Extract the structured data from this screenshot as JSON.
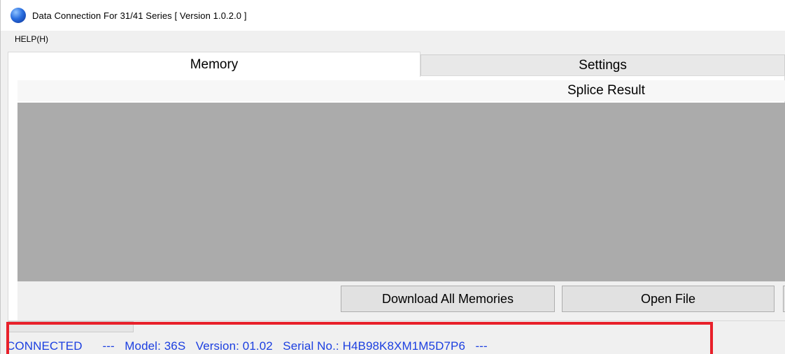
{
  "window": {
    "title": "Data Connection For 31/41 Series   [ Version 1.0.2.0 ]",
    "icon": "app-globe-icon"
  },
  "menu": {
    "items": [
      {
        "label": "HELP(H)"
      }
    ]
  },
  "tabs": [
    {
      "label": "Memory",
      "active": true
    },
    {
      "label": "Settings",
      "active": false
    }
  ],
  "panel": {
    "splice_result_label": "Splice Result",
    "buttons": {
      "download_all": "Download All Memories",
      "open_file": "Open File"
    }
  },
  "status": {
    "text": "CONNECTED      ---   Model: 36S   Version: 01.02   Serial No.: H4B98K8XM1M5D7P6   ---"
  },
  "colors": {
    "status_text": "#1c3fe0",
    "highlight_box": "#e8202a",
    "grid_background": "#ababab"
  }
}
